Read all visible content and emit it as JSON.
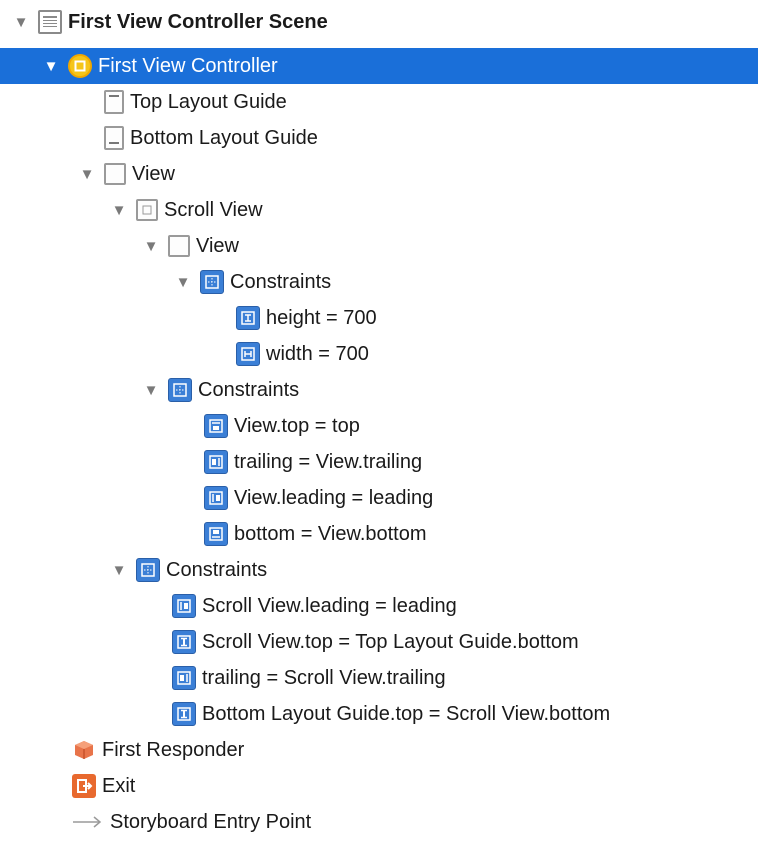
{
  "scene": {
    "title": "First View Controller Scene"
  },
  "controller": {
    "title": "First View Controller"
  },
  "rows": {
    "top_layout_guide": "Top Layout Guide",
    "bottom_layout_guide": "Bottom Layout Guide",
    "view": "View",
    "scroll_view": "Scroll View",
    "inner_view": "View",
    "constraints_inner": "Constraints",
    "height": "height = 700",
    "width": "width = 700",
    "constraints_scroll": "Constraints",
    "view_top": "View.top = top",
    "trailing_view": "trailing = View.trailing",
    "view_leading": "View.leading = leading",
    "bottom_view": "bottom = View.bottom",
    "constraints_view": "Constraints",
    "scroll_leading": "Scroll View.leading = leading",
    "scroll_top": "Scroll View.top = Top Layout Guide.bottom",
    "trailing_scroll": "trailing = Scroll View.trailing",
    "bottom_guide_top": "Bottom Layout Guide.top = Scroll View.bottom",
    "first_responder": "First Responder",
    "exit": "Exit",
    "entry_point": "Storyboard Entry Point"
  },
  "colors": {
    "selection": "#1a6fd9",
    "constraint_icon": "#3b7fd6",
    "responder": "#e8744a",
    "exit": "#e8692e"
  },
  "icons": [
    "disclosure-triangle-icon",
    "scene-icon",
    "view-controller-icon",
    "layout-guide-icon",
    "view-icon",
    "constraints-icon",
    "height-constraint-icon",
    "width-constraint-icon",
    "first-responder-icon",
    "exit-icon",
    "arrow-icon"
  ]
}
